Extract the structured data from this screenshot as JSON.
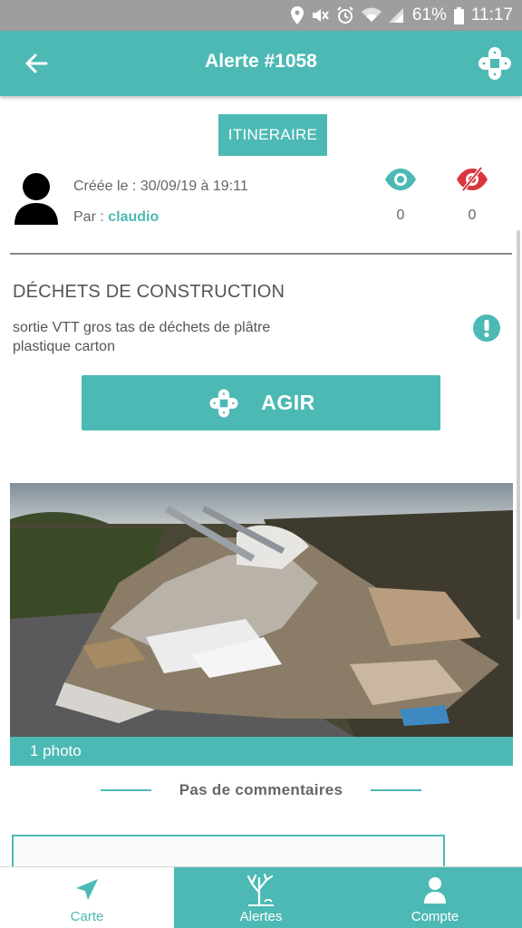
{
  "status_bar": {
    "battery": "61%",
    "time": "11:17",
    "icons": [
      "location-icon",
      "mute-icon",
      "alarm-icon",
      "wifi-icon",
      "signal-icon",
      "battery-icon"
    ]
  },
  "app_bar": {
    "title": "Alerte #1058",
    "back_icon": "arrow-left-icon",
    "action_icon": "bandage-plus-icon"
  },
  "itinerary_button": {
    "label": "ITINERAIRE"
  },
  "meta": {
    "created_label": "Créée le : 30/09/19 à 19:11",
    "by_label": "Par : ",
    "username": "claudio",
    "seen_count": "0",
    "unseen_count": "0"
  },
  "alert": {
    "category": "DÉCHETS DE CONSTRUCTION",
    "description": "sortie VTT gros tas de déchets de plâtre plastique carton"
  },
  "act_button": {
    "label": "AGIR",
    "icon": "bandage-plus-icon"
  },
  "photo": {
    "count_label": "1 photo"
  },
  "comments": {
    "empty_label": "Pas de  commentaires"
  },
  "bottom_nav": {
    "items": [
      {
        "label": "Carte",
        "icon": "navigation-arrow-icon",
        "active": true
      },
      {
        "label": "Alertes",
        "icon": "dead-tree-icon",
        "active": false
      },
      {
        "label": "Compte",
        "icon": "person-icon",
        "active": false
      }
    ]
  },
  "colors": {
    "primary": "#4db9b4",
    "danger": "#d9363e",
    "status_bar": "#9e9e9e"
  }
}
